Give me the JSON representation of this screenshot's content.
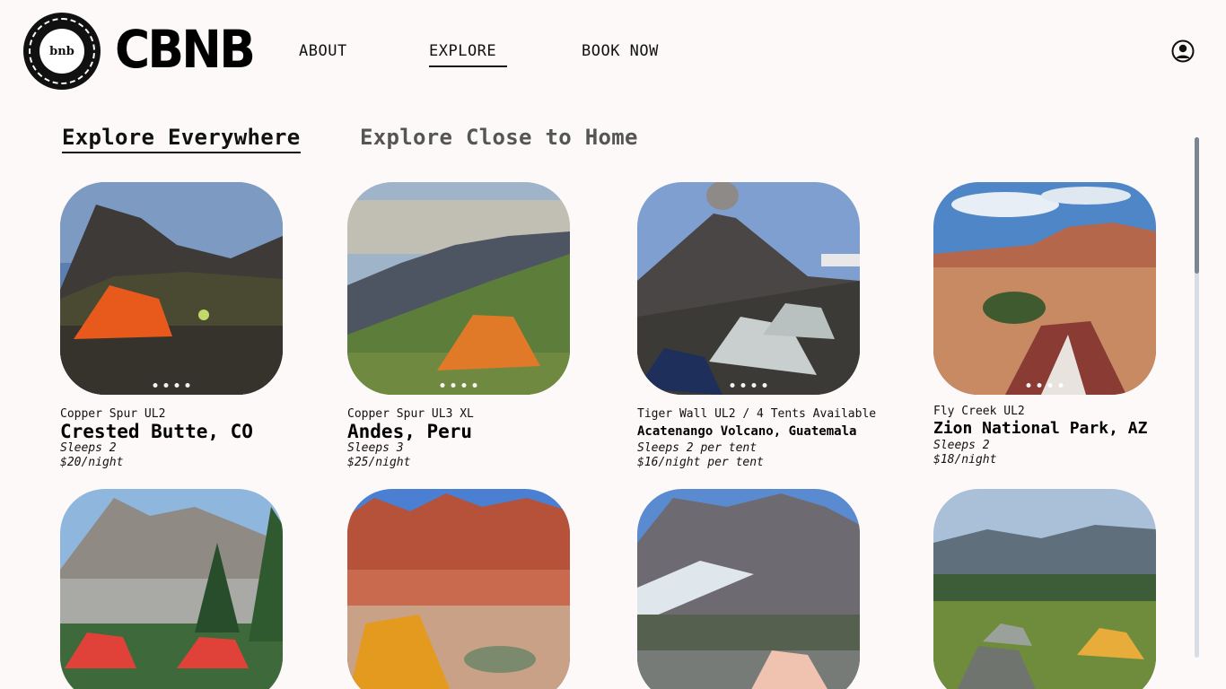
{
  "header": {
    "logo_icon": "cbnb-circle-logo",
    "logo_text": "bnb",
    "brand": "CBNB",
    "nav": [
      "ABOUT",
      "EXPLORE",
      "BOOK NOW"
    ],
    "active_nav": "EXPLORE",
    "account_icon": "user-circle-icon"
  },
  "tabs": [
    {
      "label": "Explore Everywhere",
      "active": true
    },
    {
      "label": "Explore Close to Home",
      "active": false
    }
  ],
  "listings": [
    {
      "gear": "Copper Spur UL2",
      "location": "Crested Butte, CO",
      "sleeps": "Sleeps 2",
      "price": "$20/night",
      "tent_color": "#e8591c"
    },
    {
      "gear": "Copper Spur UL3 XL",
      "location": "Andes, Peru",
      "sleeps": "Sleeps 3",
      "price": "$25/night",
      "tent_color": "#e07a28"
    },
    {
      "gear": "Tiger Wall UL2 / 4 Tents Available",
      "location": "Acatenango Volcano, Guatemala",
      "sleeps": "Sleeps 2 per tent",
      "price": "$16/night per tent",
      "tent_color": "#c9cfcf"
    },
    {
      "gear": "Fly Creek UL2",
      "location": "Zion National Park, AZ",
      "sleeps": "Sleeps 2",
      "price": "$18/night",
      "tent_color": "#8a3b34"
    },
    {
      "tent_color": "#e0423a"
    },
    {
      "tent_color": "#e39a1e"
    },
    {
      "tent_color": "#f0c2b0"
    },
    {
      "tent_color": "#6f756e"
    }
  ]
}
